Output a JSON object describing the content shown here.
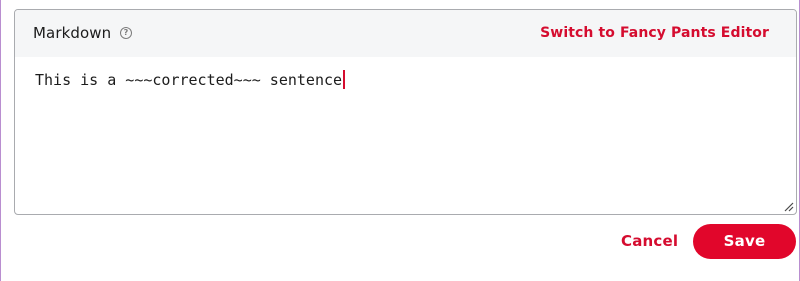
{
  "editor": {
    "mode_label": "Markdown",
    "help_icon": "question-circle-icon",
    "help_glyph": "?",
    "switch_link": "Switch to Fancy Pants Editor",
    "content": "This is a ~~~corrected~~~ sentence",
    "resize_icon": "resize-handle-icon"
  },
  "actions": {
    "cancel_label": "Cancel",
    "save_label": "Save"
  },
  "colors": {
    "accent": "#d50c2f",
    "save_background": "#e1062b",
    "header_background": "#f5f6f7",
    "border": "#a9abaf"
  }
}
